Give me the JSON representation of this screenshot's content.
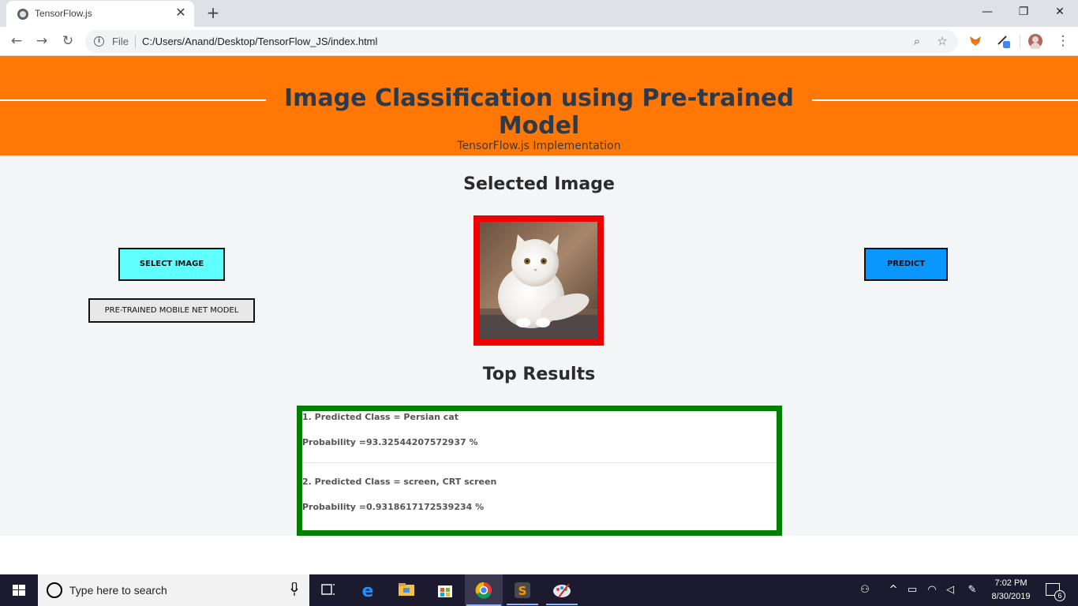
{
  "browser": {
    "tab_title": "TensorFlow.js",
    "tab_close": "✕",
    "new_tab": "+",
    "file_label": "File",
    "url": "C:/Users/Anand/Desktop/TensorFlow_JS/index.html",
    "window": {
      "minimize": "—",
      "restore": "❐",
      "close": "✕"
    }
  },
  "hero": {
    "title": "Image Classification using Pre-trained Model",
    "subtitle": "TensorFlow.js Implementation"
  },
  "selected": {
    "heading": "Selected Image",
    "select_button": "SELECT IMAGE",
    "model_button": "PRE-TRAINED MOBILE NET MODEL",
    "predict_button": "PREDICT"
  },
  "results": {
    "heading": "Top Results",
    "items": [
      {
        "class_line": "1. Predicted Class = Persian cat",
        "prob_line": "Probability =93.32544207572937 %"
      },
      {
        "class_line": "2. Predicted Class = screen, CRT screen",
        "prob_line": "Probability =0.9318617172539234 %"
      }
    ]
  },
  "taskbar": {
    "search_placeholder": "Type here to search",
    "time": "7:02 PM",
    "date": "8/30/2019",
    "notification_count": "6"
  },
  "colors": {
    "hero_bg": "#ff7805",
    "select_btn": "#5ffeff",
    "predict_btn": "#0a96ff",
    "image_border": "#ee0000",
    "results_border": "#008000"
  }
}
